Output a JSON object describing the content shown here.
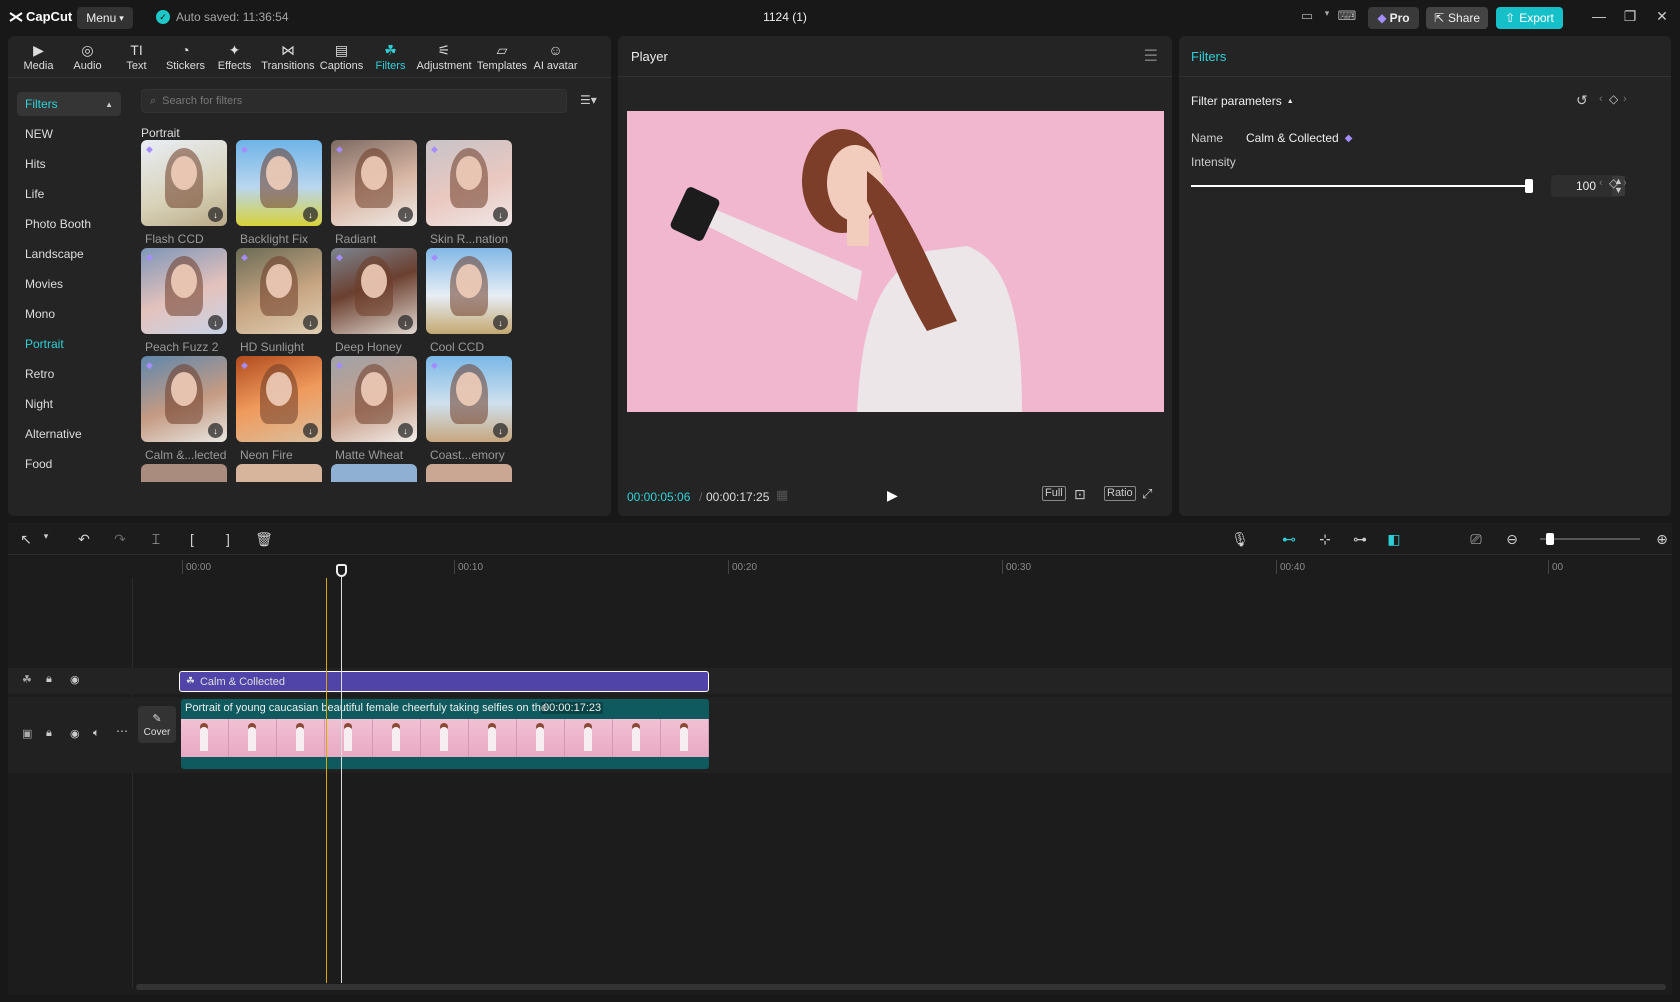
{
  "app": {
    "logo": "CapCut",
    "menu_label": "Menu",
    "autosave": "Auto saved: 11:36:54",
    "project_title": "1124 (1)",
    "pro_label": "Pro",
    "share_label": "Share",
    "export_label": "Export"
  },
  "tabs": [
    {
      "label": "Media",
      "icon": "media-icon"
    },
    {
      "label": "Audio",
      "icon": "audio-icon"
    },
    {
      "label": "Text",
      "icon": "text-icon"
    },
    {
      "label": "Stickers",
      "icon": "stickers-icon"
    },
    {
      "label": "Effects",
      "icon": "effects-icon"
    },
    {
      "label": "Transitions",
      "icon": "transitions-icon"
    },
    {
      "label": "Captions",
      "icon": "captions-icon"
    },
    {
      "label": "Filters",
      "icon": "filters-icon",
      "active": true
    },
    {
      "label": "Adjustment",
      "icon": "adjustment-icon"
    },
    {
      "label": "Templates",
      "icon": "templates-icon"
    },
    {
      "label": "AI avatar",
      "icon": "ai-avatar-icon"
    }
  ],
  "sidebar": {
    "header": "Filters",
    "categories": [
      "NEW",
      "Hits",
      "Life",
      "Photo Booth",
      "Landscape",
      "Movies",
      "Mono",
      "Portrait",
      "Retro",
      "Night",
      "Alternative",
      "Food"
    ],
    "active": "Portrait"
  },
  "search": {
    "placeholder": "Search for filters"
  },
  "section_title": "Portrait",
  "filters": [
    {
      "label": "Flash CCD"
    },
    {
      "label": "Backlight Fix"
    },
    {
      "label": "Radiant"
    },
    {
      "label": "Skin R...nation"
    },
    {
      "label": "Peach Fuzz 2"
    },
    {
      "label": "HD Sunlight"
    },
    {
      "label": "Deep Honey"
    },
    {
      "label": "Cool CCD"
    },
    {
      "label": "Calm &...lected"
    },
    {
      "label": "Neon Fire"
    },
    {
      "label": "Matte Wheat"
    },
    {
      "label": "Coast...emory"
    }
  ],
  "player": {
    "title": "Player",
    "current_time": "00:00:05:06",
    "total_time": "00:00:17:25",
    "full_label": "Full",
    "ratio_label": "Ratio"
  },
  "properties": {
    "title": "Filters",
    "section": "Filter parameters",
    "name_label": "Name",
    "name_value": "Calm & Collected",
    "intensity_label": "Intensity",
    "intensity_value": "100",
    "intensity_level": 100
  },
  "timeline": {
    "ruler": [
      "00:00",
      "00:10",
      "00:20",
      "00:30",
      "00:40",
      "00"
    ],
    "filter_clip": "Calm & Collected",
    "video_clip_title": "Portrait of young caucasian beautiful female cheerfuly taking selfies on the",
    "video_clip_duration": "00:00:17:23",
    "cover_label": "Cover"
  },
  "colors": {
    "accent": "#2ed0d8",
    "filter_clip": "#5144a8",
    "video_clip": "#0e5a5e"
  }
}
